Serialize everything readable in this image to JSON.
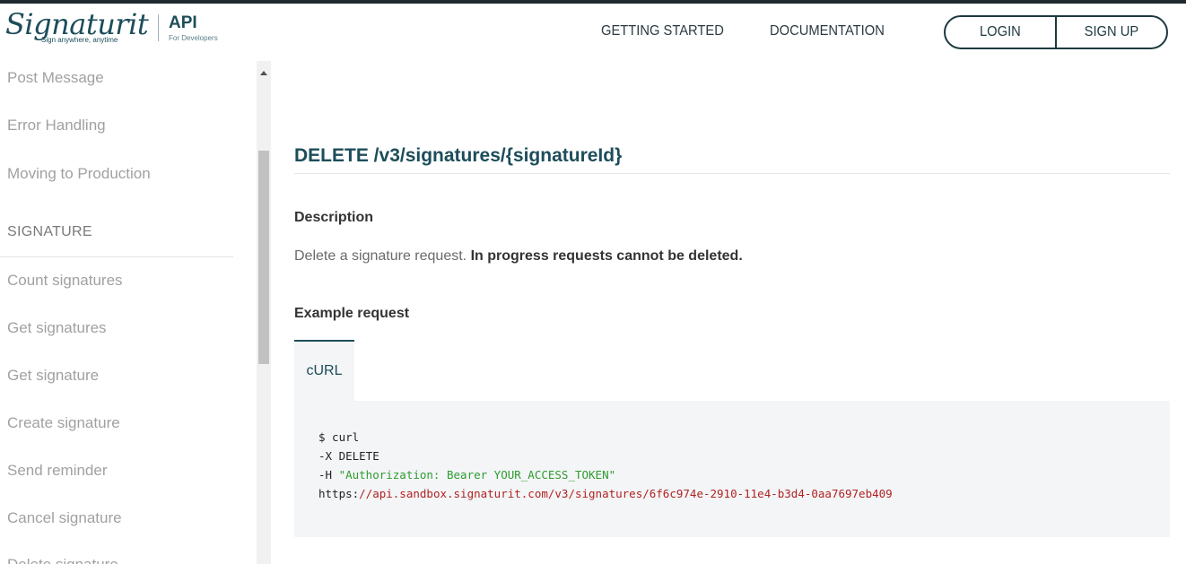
{
  "header": {
    "logo": {
      "brand": "Signaturit",
      "tagline": "Sign anywhere, anytime",
      "product": "API",
      "product_sub": "For Developers"
    },
    "nav": {
      "getting_started": "GETTING STARTED",
      "documentation": "DOCUMENTATION"
    },
    "auth": {
      "login": "LOGIN",
      "signup": "SIGN UP"
    }
  },
  "sidebar": {
    "items_top": [
      "Post Message",
      "Error Handling",
      "Moving to Production"
    ],
    "section": "SIGNATURE",
    "items": [
      "Count signatures",
      "Get signatures",
      "Get signature",
      "Create signature",
      "Send reminder",
      "Cancel signature",
      "Delete signature"
    ]
  },
  "main": {
    "endpoint": "DELETE /v3/signatures/{signatureId}",
    "description_heading": "Description",
    "description_text": "Delete a signature request.",
    "description_bold": "In progress requests cannot be deleted.",
    "example_heading": "Example request",
    "tab_label": "cURL",
    "code": {
      "line1": "$ curl",
      "line2": "-X DELETE",
      "line3_flag": "-H ",
      "line3_str": "\"Authorization: Bearer YOUR_ACCESS_TOKEN\"",
      "line4_scheme": "https:",
      "line4_rest": "//api.sandbox.signaturit.com/v3/signatures/6f6c974e-2910-11e4-b3d4-0aa7697eb409"
    }
  },
  "colors": {
    "brand": "#1d4d5a",
    "code_bg": "#f3f5f7",
    "code_string": "#2f9b2f",
    "code_url": "#b22222"
  }
}
